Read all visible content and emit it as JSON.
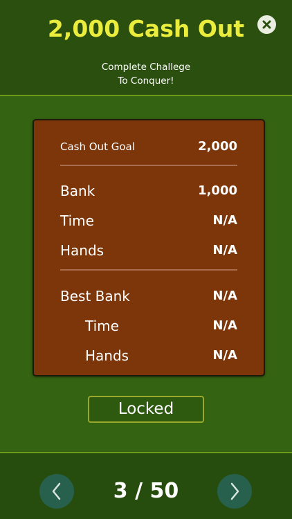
{
  "header": {
    "title": "2,000 Cash Out",
    "subtitle_line1": "Complete Challege",
    "subtitle_line2": "To Conquer!",
    "close_icon": "close-icon"
  },
  "card": {
    "goal": {
      "label": "Cash Out Goal",
      "value": "2,000"
    },
    "current": [
      {
        "label": "Bank",
        "value": "1,000"
      },
      {
        "label": "Time",
        "value": "N/A"
      },
      {
        "label": "Hands",
        "value": "N/A"
      }
    ],
    "best": [
      {
        "label": "Best Bank",
        "value": "N/A"
      },
      {
        "label": "Time",
        "value": "N/A"
      },
      {
        "label": "Hands",
        "value": "N/A"
      }
    ]
  },
  "locked_label": "Locked",
  "pager": {
    "text": "3 / 50",
    "prev_icon": "chevron-left-icon",
    "next_icon": "chevron-right-icon"
  },
  "colors": {
    "title_yellow": "#ebed3c",
    "header_green": "#2a4f0e",
    "main_green": "#346311",
    "card_brown": "#7c3609",
    "nav_teal": "#27604d",
    "accent_line": "#6e9a1c"
  }
}
